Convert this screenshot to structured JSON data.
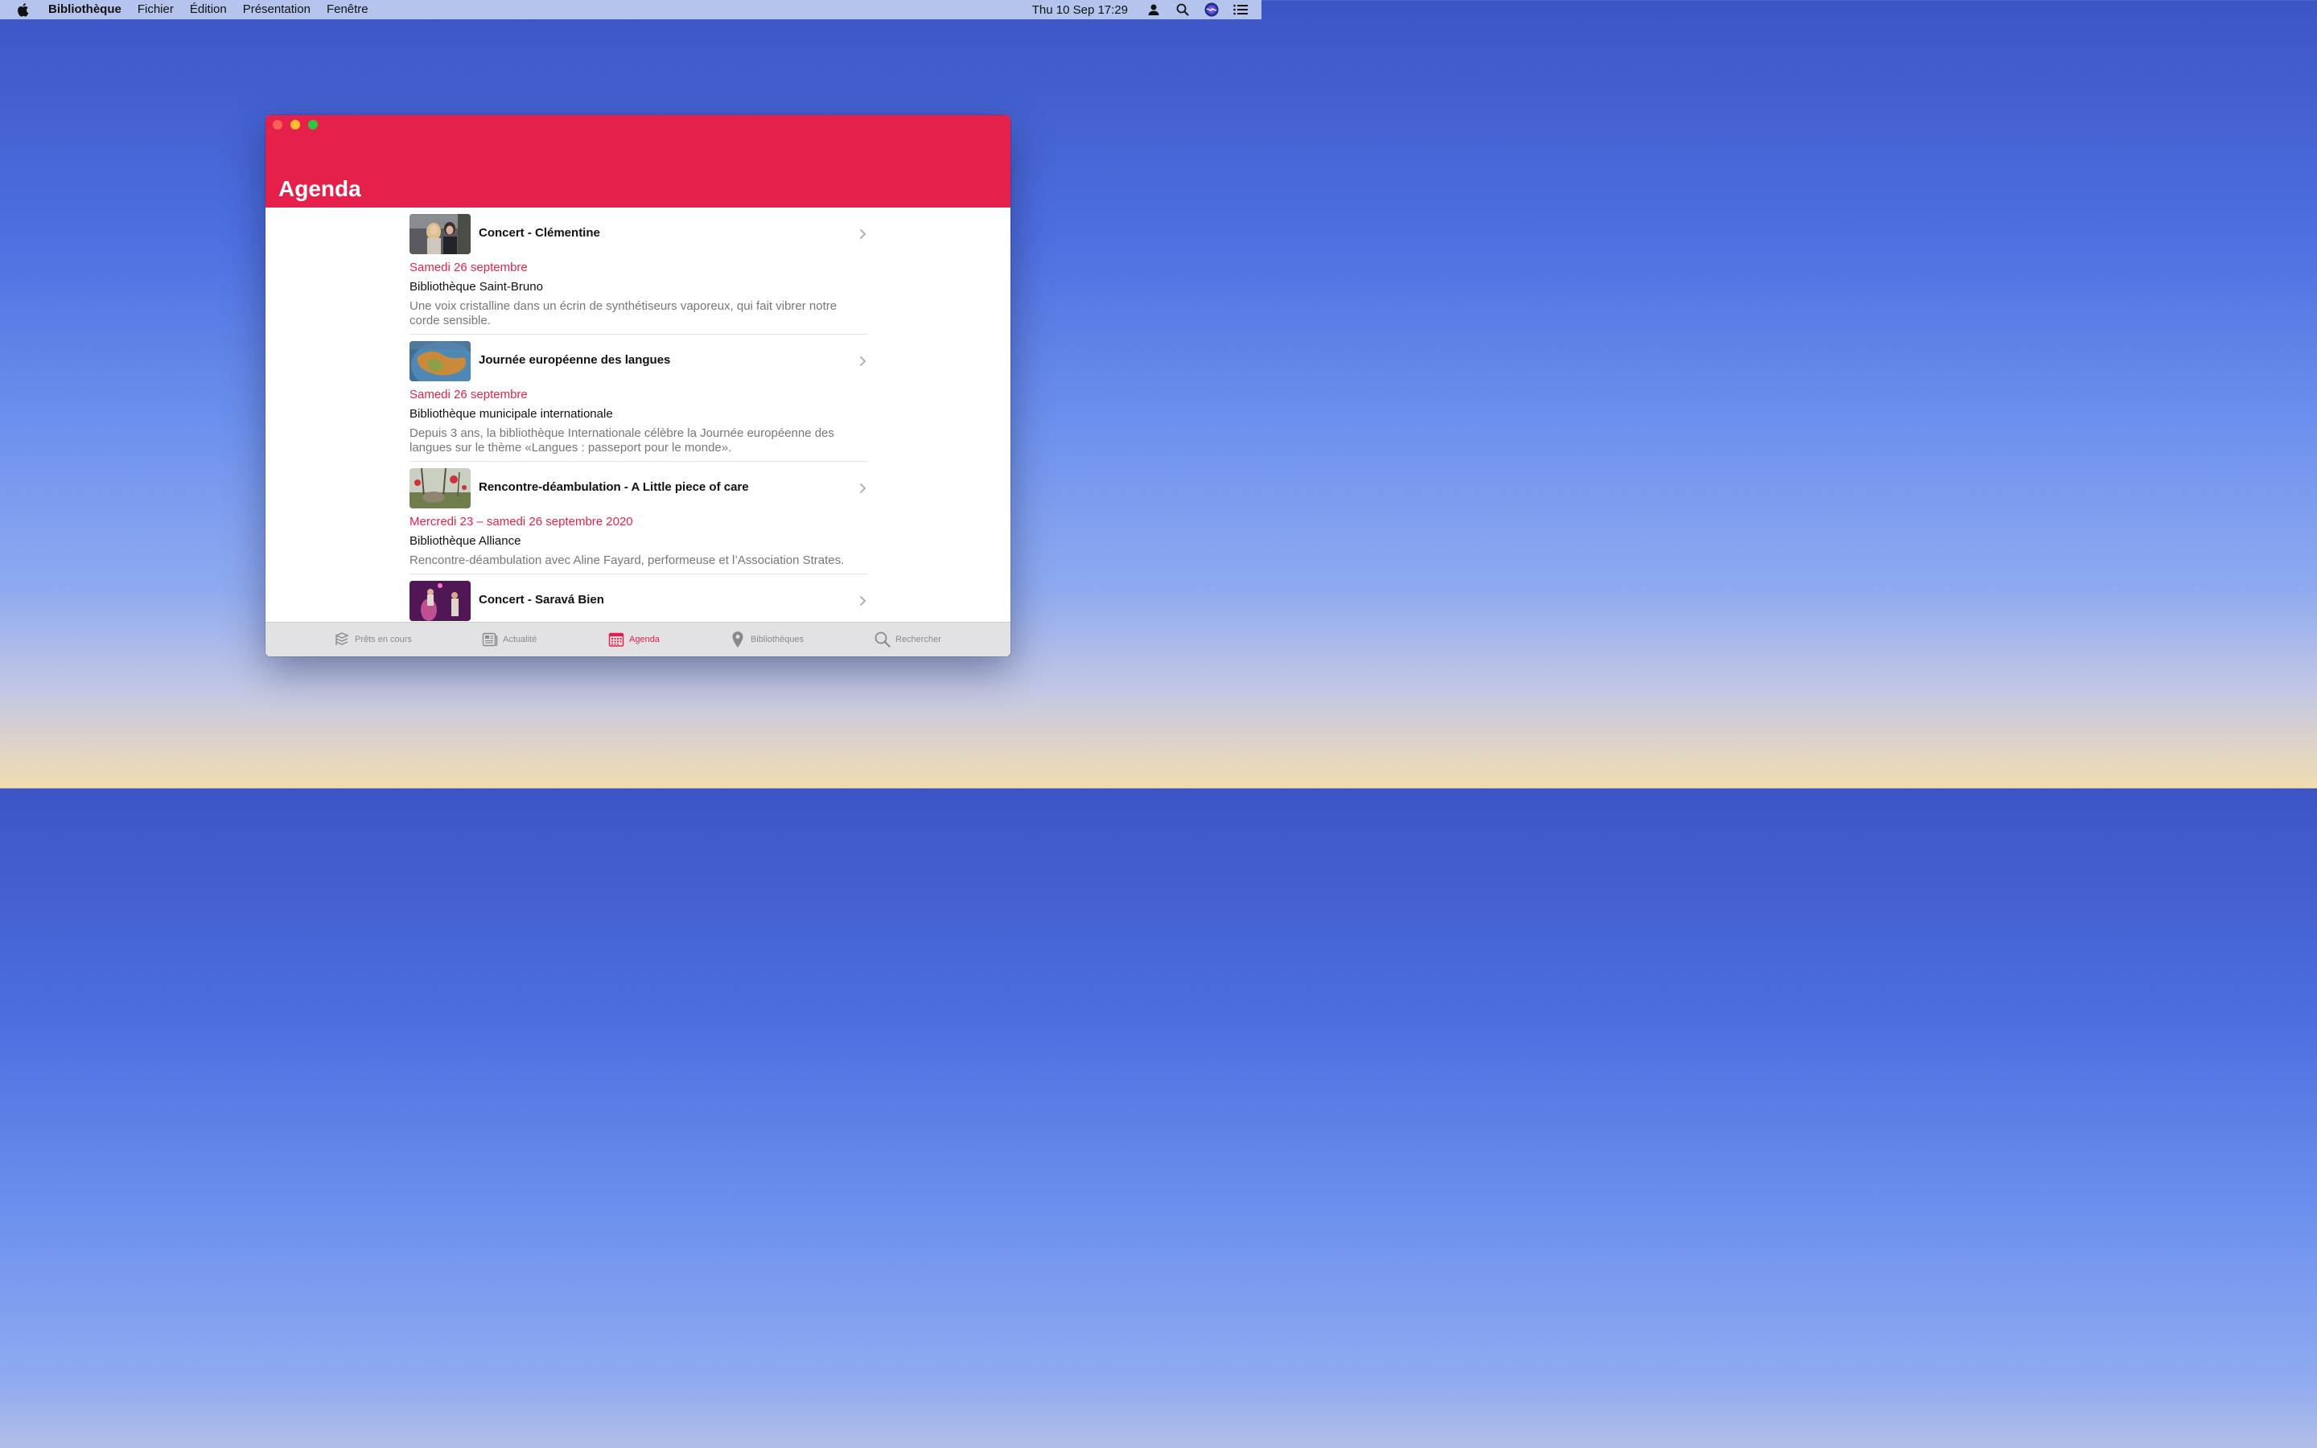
{
  "menubar": {
    "app_name": "Bibliothèque",
    "menus": [
      "Fichier",
      "Édition",
      "Présentation",
      "Fenêtre"
    ],
    "clock": "Thu 10 Sep  17:29"
  },
  "window": {
    "title": "Agenda",
    "accent_color": "#e5214b"
  },
  "events": [
    {
      "title": "Concert - Clémentine",
      "date": "Samedi 26 septembre",
      "place": "Bibliothèque Saint-Bruno",
      "description": "Une voix cristalline dans un écrin de synthétiseurs vaporeux, qui fait vibrer notre corde sensible."
    },
    {
      "title": "Journée européenne des langues",
      "date": "Samedi 26 septembre",
      "place": "Bibliothèque municipale internationale",
      "description": "Depuis 3 ans, la bibliothèque Internationale célèbre la Journée européenne des langues sur le thème «Langues : passeport pour le monde»."
    },
    {
      "title": "Rencontre-déambulation - A Little  piece  of care",
      "date": "Mercredi 23 – samedi 26 septembre 2020",
      "place": "Bibliothèque Alliance",
      "description": "Rencontre-déambulation avec Aline Fayard, performeuse et l’Association Strates."
    },
    {
      "title": "Concert - Saravá Bien"
    }
  ],
  "tabs": [
    {
      "label": "Prêts en cours",
      "icon": "books-icon"
    },
    {
      "label": "Actualité",
      "icon": "newspaper-icon"
    },
    {
      "label": "Agenda",
      "icon": "calendar-icon",
      "active": true
    },
    {
      "label": "Bibliothèques",
      "icon": "map-pin-icon"
    },
    {
      "label": "Rechercher",
      "icon": "search-icon"
    }
  ]
}
